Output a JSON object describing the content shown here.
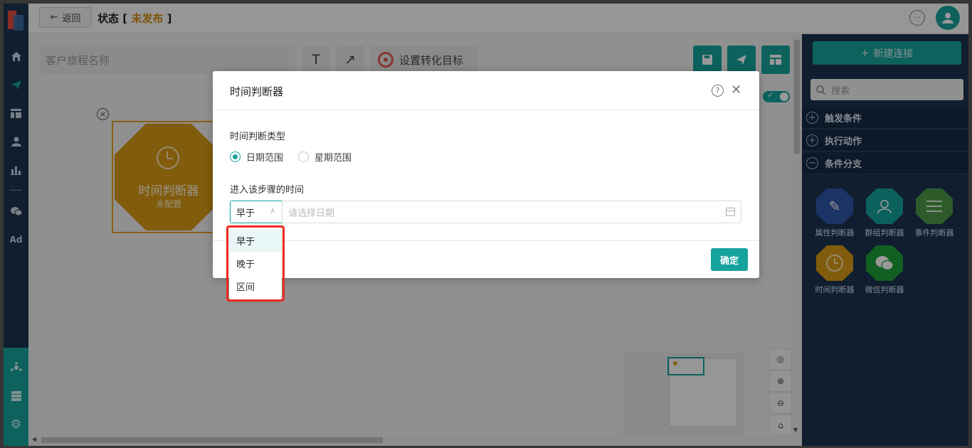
{
  "topbar": {
    "back_label": "返回",
    "status_prefix": "状态",
    "status_state": "未发布",
    "bracket_open": "[",
    "bracket_close": "]"
  },
  "canvas": {
    "journey_name_placeholder": "客户旅程名称",
    "text_tool": "T",
    "arrow_tool": "↗",
    "goal_label": "设置转化目标",
    "node": {
      "title": "时间判断器",
      "subtitle": "未配置"
    }
  },
  "right_panel": {
    "new_connection": "新建连接",
    "search_placeholder": "搜索",
    "sections": [
      {
        "label": "触发条件",
        "expanded": false
      },
      {
        "label": "执行动作",
        "expanded": false
      },
      {
        "label": "条件分支",
        "expanded": true
      }
    ],
    "tiles": [
      {
        "label": "属性判断器",
        "icon": "edit-icon",
        "color": "#2f56a8"
      },
      {
        "label": "群组判断器",
        "icon": "group-user-icon",
        "color": "#14a29c"
      },
      {
        "label": "事件判断器",
        "icon": "list-icon",
        "color": "#4c9a46"
      },
      {
        "label": "时间判断器",
        "icon": "clock-icon",
        "color": "#d89a14"
      },
      {
        "label": "微信判断器",
        "icon": "wechat-icon",
        "color": "#1f9e3a"
      }
    ]
  },
  "modal": {
    "title": "时间判断器",
    "type_label": "时间判断类型",
    "radio_date": "日期范围",
    "radio_week": "星期范围",
    "selected_type": "日期范围",
    "enter_time_label": "进入该步骤的时间",
    "compare_value": "早于",
    "date_placeholder": "请选择日期",
    "ok_label": "确定"
  },
  "dropdown": {
    "options": [
      "早于",
      "晚于",
      "区间"
    ],
    "selected": "早于"
  },
  "colors": {
    "accent": "#16a39d",
    "nav_bg": "#1b3350",
    "node_orange": "#d89a14",
    "highlight": "#ee2b22"
  }
}
